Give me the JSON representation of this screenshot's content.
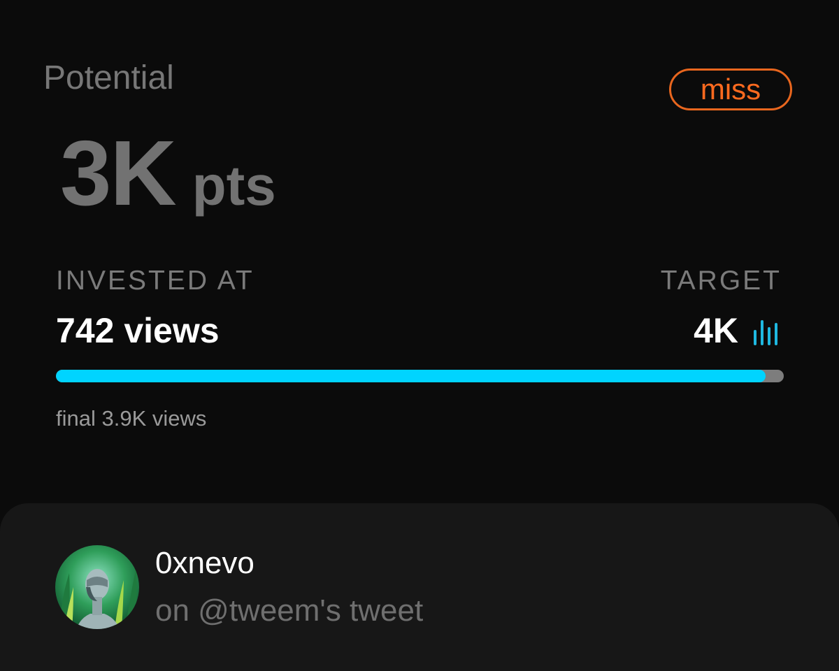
{
  "header": {
    "title": "Potential",
    "status_badge": "miss"
  },
  "points": {
    "value": "3K",
    "unit": "pts"
  },
  "invested": {
    "label": "INVESTED AT",
    "value": "742 views"
  },
  "target": {
    "label": "TARGET",
    "value": "4K",
    "icon": "bar-chart-icon"
  },
  "progress": {
    "fraction": 0.975,
    "note": "final 3.9K views"
  },
  "colors": {
    "accent": "#00d4ff",
    "badge": "#ff6a1f"
  },
  "post": {
    "username": "0xnevo",
    "context": "on @tweem's tweet"
  }
}
